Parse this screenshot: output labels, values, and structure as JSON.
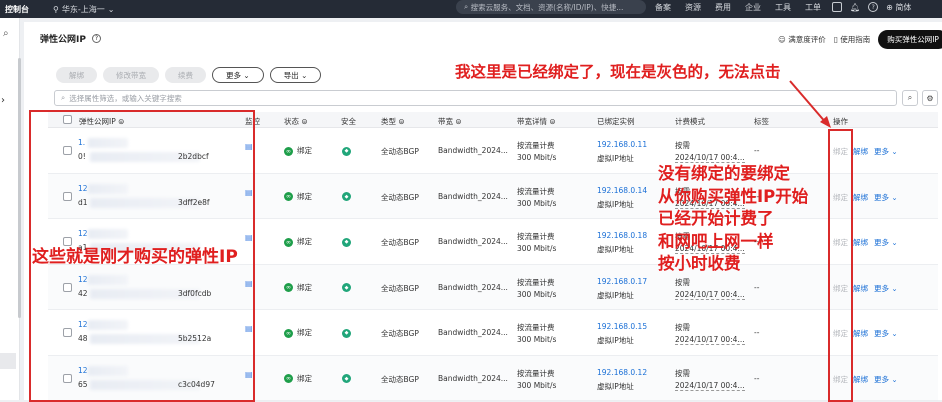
{
  "topbar": {
    "brand": "控制台",
    "region": "华东-上海一",
    "search_placeholder": "搜索云服务、文档、资源(名称/ID/IP)、快捷...",
    "nav": [
      "备案",
      "资源",
      "费用",
      "企业",
      "工具",
      "工单"
    ],
    "lang": "简体"
  },
  "page": {
    "title": "弹性公网IP",
    "feedback": "满意度评价",
    "guide": "使用指南",
    "buy_button": "购买弹性公网IP"
  },
  "toolbar": {
    "unbind": "解绑",
    "modify_bw": "修改带宽",
    "renew": "续费",
    "more": "更多",
    "export": "导出"
  },
  "filter_placeholder": "选择属性筛选，或输入关键字搜索",
  "columns": {
    "eip": "弹性公网IP",
    "monitor": "监控",
    "status": "状态",
    "safe": "安全",
    "type": "类型",
    "bandwidth": "带宽",
    "bw_detail": "带宽详情",
    "bound": "已绑定实例",
    "billing": "计费模式",
    "tag": "标签",
    "action": "操作"
  },
  "rows": [
    {
      "ip_prefix": "1.",
      "id_prefix": "0!",
      "id_suffix": "2b2dbcf",
      "bound_ip": "192.168.0.11"
    },
    {
      "ip_prefix": "12",
      "id_prefix": "d1",
      "id_suffix": "3dff2e8f",
      "bound_ip": "192.168.0.14"
    },
    {
      "ip_prefix": "12",
      "id_prefix": "a1",
      "id_suffix": "",
      "bound_ip": "192.168.0.18"
    },
    {
      "ip_prefix": "12",
      "id_prefix": "42",
      "id_suffix": "3df0fcdb",
      "bound_ip": "192.168.0.17"
    },
    {
      "ip_prefix": "12",
      "id_prefix": "48",
      "id_suffix": "5b2512a",
      "bound_ip": "192.168.0.15"
    },
    {
      "ip_prefix": "12",
      "id_prefix": "65",
      "id_suffix": "c3c04d97",
      "bound_ip": "192.168.0.12"
    }
  ],
  "row_common": {
    "status": "绑定",
    "type": "全动态BGP",
    "bandwidth": "Bandwidth_2024...",
    "bw_mode": "按流量计费",
    "bw_speed": "300 Mbit/s",
    "bound_label": "虚拟IP地址",
    "billing_mode": "按需",
    "billing_time": "2024/10/17 00:4...",
    "tag": "--",
    "bind": "绑定",
    "unbind": "解绑",
    "more": "更多"
  },
  "annotations": {
    "top": "我这里是已经绑定了，现在是灰色的，无法点击",
    "left": "这些就是刚才购买的弹性IP",
    "right": [
      "没有绑定的要绑定",
      "从你购买弹性IP开始",
      "已经开始计费了",
      "和网吧上网一样",
      "按小时收费"
    ],
    "color": "#e01f1f"
  }
}
